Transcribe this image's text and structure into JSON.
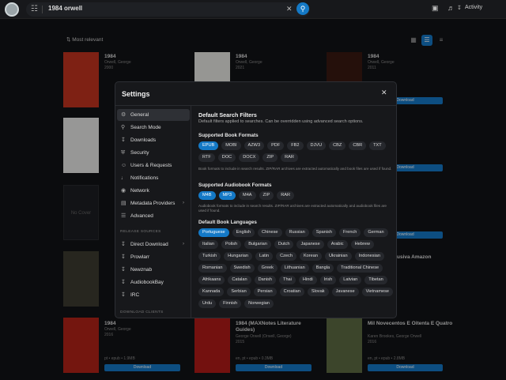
{
  "topbar": {
    "query": "1984 orwell",
    "activity_label": "Activity"
  },
  "toolbar": {
    "sort_label": "Most relevant"
  },
  "cards": [
    {
      "title": "1984",
      "author": "Orwell, George",
      "year": "2000"
    },
    {
      "title": "1984",
      "author": "Orwell, George",
      "year": "2021"
    },
    {
      "title": "1984",
      "author": "Orwell, George",
      "year": "2011"
    },
    {
      "title": "1984",
      "author": "Orwell, George",
      "year": "2016",
      "info": "pt • epub • 1.9MB",
      "download": "Download"
    },
    {
      "title": "1984 (MAXNotes Literature Guides)",
      "author": "George Orwell (Orwell, George)",
      "year": "2015",
      "info": "en, pt • epub • 0.3MB",
      "download": "Download"
    },
    {
      "title": "Mil Novecentos E Oitenta E Quatro",
      "author": "Karen Brookes, George Orwell",
      "year": "2016",
      "info": "en, pt • epub • 2.8MB",
      "download": "Download"
    }
  ],
  "card_fragments": {
    "download": "Download",
    "peek_text": "usiva Amazon",
    "no_cover": "No Cover"
  },
  "modal": {
    "title": "Settings",
    "nav": [
      {
        "label": "General",
        "icon": "gear-icon"
      },
      {
        "label": "Search Mode",
        "icon": "search-icon"
      },
      {
        "label": "Downloads",
        "icon": "download-icon"
      },
      {
        "label": "Security",
        "icon": "shield-icon"
      },
      {
        "label": "Users & Requests",
        "icon": "users-icon"
      },
      {
        "label": "Notifications",
        "icon": "bell-icon"
      },
      {
        "label": "Network",
        "icon": "globe-icon"
      },
      {
        "label": "Metadata Providers",
        "icon": "database-icon"
      },
      {
        "label": "Advanced",
        "icon": "sliders-icon"
      }
    ],
    "release_sources_label": "RELEASE SOURCES",
    "sources": [
      {
        "label": "Direct Download"
      },
      {
        "label": "Prowlarr"
      },
      {
        "label": "Newznab"
      },
      {
        "label": "AudiobookBay"
      },
      {
        "label": "IRC"
      }
    ],
    "download_clients_label": "DOWNLOAD CLIENTS",
    "section_title": "Default Search Filters",
    "section_desc": "Default filters applied to searches. Can be overridden using advanced search options.",
    "book_formats": {
      "title": "Supported Book Formats",
      "items": [
        {
          "label": "EPUB",
          "on": true
        },
        {
          "label": "MOBI",
          "on": false
        },
        {
          "label": "AZW3",
          "on": false
        },
        {
          "label": "PDF",
          "on": false
        },
        {
          "label": "FB2",
          "on": false
        },
        {
          "label": "DJVU",
          "on": false
        },
        {
          "label": "CBZ",
          "on": false
        },
        {
          "label": "CBR",
          "on": false
        },
        {
          "label": "TXT",
          "on": false
        },
        {
          "label": "RTF",
          "on": false
        },
        {
          "label": "DOC",
          "on": false
        },
        {
          "label": "DOCX",
          "on": false
        },
        {
          "label": "ZIP",
          "on": false
        },
        {
          "label": "RAR",
          "on": false
        }
      ],
      "hint": "Book formats to include in search results. ZIP/RAR archives are extracted automatically and book files are used if found."
    },
    "audio_formats": {
      "title": "Supported Audiobook Formats",
      "items": [
        {
          "label": "M4B",
          "on": true
        },
        {
          "label": "MP3",
          "on": true
        },
        {
          "label": "M4A",
          "on": false
        },
        {
          "label": "ZIP",
          "on": false
        },
        {
          "label": "RAR",
          "on": false
        }
      ],
      "hint": "Audiobook formats to include in search results. ZIP/RAR archives are extracted automatically and audiobook files are used if found."
    },
    "languages": {
      "title": "Default Book Languages",
      "items": [
        {
          "label": "Portuguese",
          "on": true
        },
        {
          "label": "English",
          "on": false
        },
        {
          "label": "Chinese",
          "on": false
        },
        {
          "label": "Russian",
          "on": false
        },
        {
          "label": "Spanish",
          "on": false
        },
        {
          "label": "French",
          "on": false
        },
        {
          "label": "German",
          "on": false
        },
        {
          "label": "Italian",
          "on": false
        },
        {
          "label": "Polish",
          "on": false
        },
        {
          "label": "Bulgarian",
          "on": false
        },
        {
          "label": "Dutch",
          "on": false
        },
        {
          "label": "Japanese",
          "on": false
        },
        {
          "label": "Arabic",
          "on": false
        },
        {
          "label": "Hebrew",
          "on": false
        },
        {
          "label": "Turkish",
          "on": false
        },
        {
          "label": "Hungarian",
          "on": false
        },
        {
          "label": "Latin",
          "on": false
        },
        {
          "label": "Czech",
          "on": false
        },
        {
          "label": "Korean",
          "on": false
        },
        {
          "label": "Ukrainian",
          "on": false
        },
        {
          "label": "Indonesian",
          "on": false
        },
        {
          "label": "Romanian",
          "on": false
        },
        {
          "label": "Swedish",
          "on": false
        },
        {
          "label": "Greek",
          "on": false
        },
        {
          "label": "Lithuanian",
          "on": false
        },
        {
          "label": "Bangla",
          "on": false
        },
        {
          "label": "Traditional Chinese",
          "on": false
        },
        {
          "label": "Afrikaans",
          "on": false
        },
        {
          "label": "Catalan",
          "on": false
        },
        {
          "label": "Danish",
          "on": false
        },
        {
          "label": "Thai",
          "on": false
        },
        {
          "label": "Hindi",
          "on": false
        },
        {
          "label": "Irish",
          "on": false
        },
        {
          "label": "Latvian",
          "on": false
        },
        {
          "label": "Tibetan",
          "on": false
        },
        {
          "label": "Kannada",
          "on": false
        },
        {
          "label": "Serbian",
          "on": false
        },
        {
          "label": "Persian",
          "on": false
        },
        {
          "label": "Croatian",
          "on": false
        },
        {
          "label": "Slovak",
          "on": false
        },
        {
          "label": "Javanese",
          "on": false
        },
        {
          "label": "Vietnamese",
          "on": false
        },
        {
          "label": "Urdu",
          "on": false
        },
        {
          "label": "Finnish",
          "on": false
        },
        {
          "label": "Norwegian",
          "on": false
        }
      ]
    }
  },
  "colors": {
    "accent": "#1479c6",
    "panel": "#17181b",
    "chip": "#26282d"
  }
}
